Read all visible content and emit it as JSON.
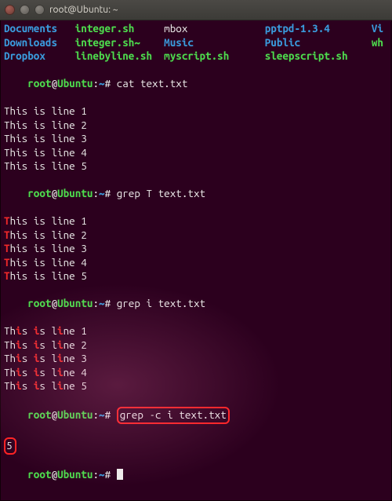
{
  "titlebar": {
    "title": "root@Ubuntu: ~"
  },
  "prompt": {
    "user": "root",
    "host": "Ubuntu",
    "path": "~",
    "sep": "#"
  },
  "ls": {
    "row1": [
      {
        "t": "Documents",
        "c": "b"
      },
      {
        "pad": "   "
      },
      {
        "t": "integer.sh",
        "c": "g"
      },
      {
        "pad": "     "
      },
      {
        "t": "mbox",
        "c": "w"
      },
      {
        "pad": "             "
      },
      {
        "t": "pptpd-1.3.4",
        "c": "b"
      },
      {
        "pad": "       "
      },
      {
        "t": "Vi",
        "c": "b"
      }
    ],
    "row2": [
      {
        "t": "Downloads",
        "c": "b"
      },
      {
        "pad": "   "
      },
      {
        "t": "integer.sh~",
        "c": "g"
      },
      {
        "pad": "    "
      },
      {
        "t": "Music",
        "c": "b"
      },
      {
        "pad": "            "
      },
      {
        "t": "Public",
        "c": "b"
      },
      {
        "pad": "            "
      },
      {
        "t": "wh",
        "c": "g"
      }
    ],
    "row3": [
      {
        "t": "Dropbox",
        "c": "b"
      },
      {
        "pad": "     "
      },
      {
        "t": "linebyline.sh",
        "c": "g"
      },
      {
        "pad": "  "
      },
      {
        "t": "myscript.sh",
        "c": "g"
      },
      {
        "pad": "      "
      },
      {
        "t": "sleepscript.sh",
        "c": "g"
      },
      {
        "pad": "    "
      }
    ]
  },
  "commands": {
    "cmd1": "cat text.txt",
    "cmd2": "grep T text.txt",
    "cmd3": "grep i text.txt",
    "cmd4": "grep -c i text.txt",
    "out4": "5"
  },
  "catlines": [
    "This is line 1",
    "This is line 2",
    "This is line 3",
    "This is line 4",
    "This is line 5"
  ],
  "grepT": [
    [
      {
        "h": "T"
      },
      {
        "t": "his is line 1"
      }
    ],
    [
      {
        "h": "T"
      },
      {
        "t": "his is line 2"
      }
    ],
    [
      {
        "h": "T"
      },
      {
        "t": "his is line 3"
      }
    ],
    [
      {
        "h": "T"
      },
      {
        "t": "his is line 4"
      }
    ],
    [
      {
        "h": "T"
      },
      {
        "t": "his is line 5"
      }
    ]
  ],
  "grepi": [
    [
      {
        "t": "Th"
      },
      {
        "h": "i"
      },
      {
        "t": "s "
      },
      {
        "h": "i"
      },
      {
        "t": "s l"
      },
      {
        "h": "i"
      },
      {
        "t": "ne 1"
      }
    ],
    [
      {
        "t": "Th"
      },
      {
        "h": "i"
      },
      {
        "t": "s "
      },
      {
        "h": "i"
      },
      {
        "t": "s l"
      },
      {
        "h": "i"
      },
      {
        "t": "ne 2"
      }
    ],
    [
      {
        "t": "Th"
      },
      {
        "h": "i"
      },
      {
        "t": "s "
      },
      {
        "h": "i"
      },
      {
        "t": "s l"
      },
      {
        "h": "i"
      },
      {
        "t": "ne 3"
      }
    ],
    [
      {
        "t": "Th"
      },
      {
        "h": "i"
      },
      {
        "t": "s "
      },
      {
        "h": "i"
      },
      {
        "t": "s l"
      },
      {
        "h": "i"
      },
      {
        "t": "ne 4"
      }
    ],
    [
      {
        "t": "Th"
      },
      {
        "h": "i"
      },
      {
        "t": "s "
      },
      {
        "h": "i"
      },
      {
        "t": "s l"
      },
      {
        "h": "i"
      },
      {
        "t": "ne 5"
      }
    ]
  ]
}
